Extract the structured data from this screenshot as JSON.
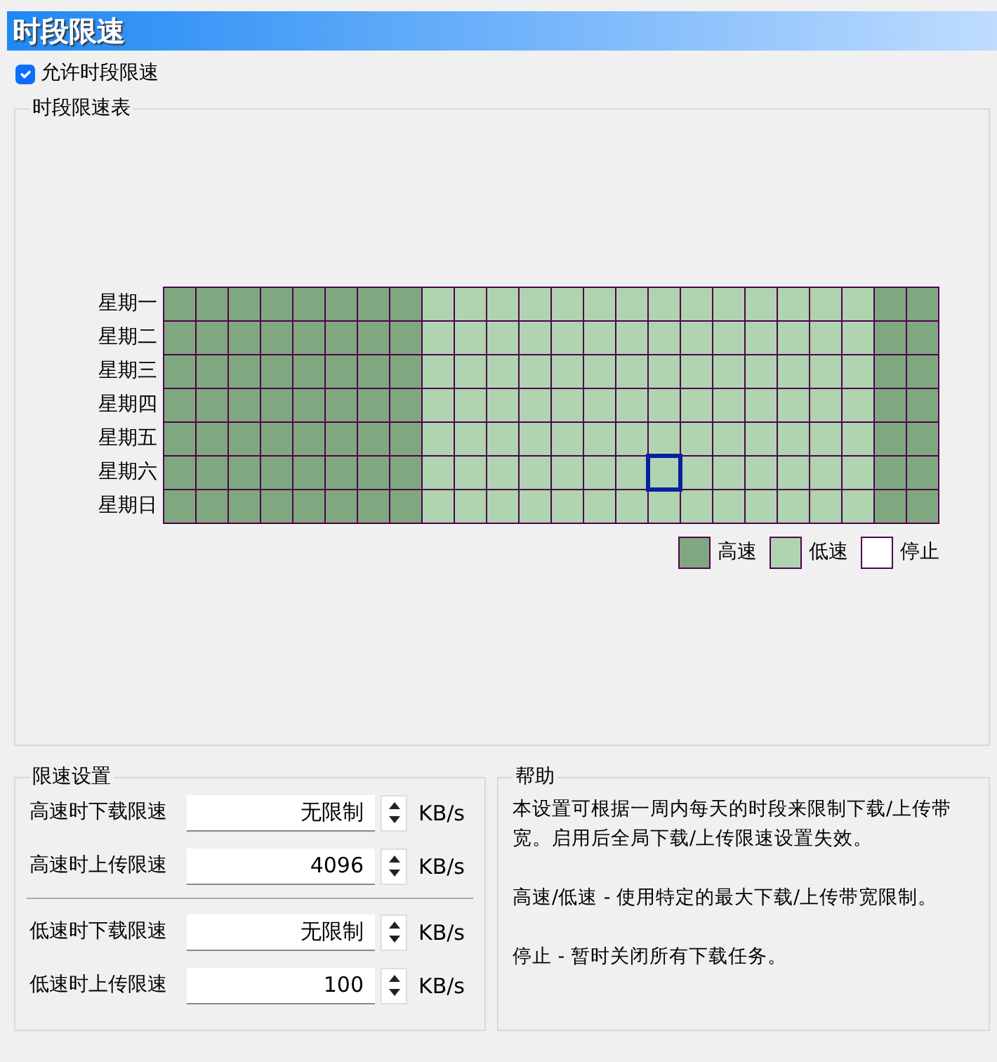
{
  "window": {
    "title": "时段限速"
  },
  "enable": {
    "label": "允许时段限速",
    "checked": true
  },
  "schedule": {
    "title": "时段限速表",
    "rows": [
      {
        "day": "星期一",
        "cells": [
          {
            "kind": "high",
            "selected": false
          },
          {
            "kind": "high",
            "selected": false
          },
          {
            "kind": "high",
            "selected": false
          },
          {
            "kind": "high",
            "selected": false
          },
          {
            "kind": "high",
            "selected": false
          },
          {
            "kind": "high",
            "selected": false
          },
          {
            "kind": "high",
            "selected": false
          },
          {
            "kind": "high",
            "selected": false
          },
          {
            "kind": "low",
            "selected": false
          },
          {
            "kind": "low",
            "selected": false
          },
          {
            "kind": "low",
            "selected": false
          },
          {
            "kind": "low",
            "selected": false
          },
          {
            "kind": "low",
            "selected": false
          },
          {
            "kind": "low",
            "selected": false
          },
          {
            "kind": "low",
            "selected": false
          },
          {
            "kind": "low",
            "selected": false
          },
          {
            "kind": "low",
            "selected": false
          },
          {
            "kind": "low",
            "selected": false
          },
          {
            "kind": "low",
            "selected": false
          },
          {
            "kind": "low",
            "selected": false
          },
          {
            "kind": "low",
            "selected": false
          },
          {
            "kind": "low",
            "selected": false
          },
          {
            "kind": "high",
            "selected": false
          },
          {
            "kind": "high",
            "selected": false
          }
        ]
      },
      {
        "day": "星期二",
        "cells": [
          {
            "kind": "high",
            "selected": false
          },
          {
            "kind": "high",
            "selected": false
          },
          {
            "kind": "high",
            "selected": false
          },
          {
            "kind": "high",
            "selected": false
          },
          {
            "kind": "high",
            "selected": false
          },
          {
            "kind": "high",
            "selected": false
          },
          {
            "kind": "high",
            "selected": false
          },
          {
            "kind": "high",
            "selected": false
          },
          {
            "kind": "low",
            "selected": false
          },
          {
            "kind": "low",
            "selected": false
          },
          {
            "kind": "low",
            "selected": false
          },
          {
            "kind": "low",
            "selected": false
          },
          {
            "kind": "low",
            "selected": false
          },
          {
            "kind": "low",
            "selected": false
          },
          {
            "kind": "low",
            "selected": false
          },
          {
            "kind": "low",
            "selected": false
          },
          {
            "kind": "low",
            "selected": false
          },
          {
            "kind": "low",
            "selected": false
          },
          {
            "kind": "low",
            "selected": false
          },
          {
            "kind": "low",
            "selected": false
          },
          {
            "kind": "low",
            "selected": false
          },
          {
            "kind": "low",
            "selected": false
          },
          {
            "kind": "high",
            "selected": false
          },
          {
            "kind": "high",
            "selected": false
          }
        ]
      },
      {
        "day": "星期三",
        "cells": [
          {
            "kind": "high",
            "selected": false
          },
          {
            "kind": "high",
            "selected": false
          },
          {
            "kind": "high",
            "selected": false
          },
          {
            "kind": "high",
            "selected": false
          },
          {
            "kind": "high",
            "selected": false
          },
          {
            "kind": "high",
            "selected": false
          },
          {
            "kind": "high",
            "selected": false
          },
          {
            "kind": "high",
            "selected": false
          },
          {
            "kind": "low",
            "selected": false
          },
          {
            "kind": "low",
            "selected": false
          },
          {
            "kind": "low",
            "selected": false
          },
          {
            "kind": "low",
            "selected": false
          },
          {
            "kind": "low",
            "selected": false
          },
          {
            "kind": "low",
            "selected": false
          },
          {
            "kind": "low",
            "selected": false
          },
          {
            "kind": "low",
            "selected": false
          },
          {
            "kind": "low",
            "selected": false
          },
          {
            "kind": "low",
            "selected": false
          },
          {
            "kind": "low",
            "selected": false
          },
          {
            "kind": "low",
            "selected": false
          },
          {
            "kind": "low",
            "selected": false
          },
          {
            "kind": "low",
            "selected": false
          },
          {
            "kind": "high",
            "selected": false
          },
          {
            "kind": "high",
            "selected": false
          }
        ]
      },
      {
        "day": "星期四",
        "cells": [
          {
            "kind": "high",
            "selected": false
          },
          {
            "kind": "high",
            "selected": false
          },
          {
            "kind": "high",
            "selected": false
          },
          {
            "kind": "high",
            "selected": false
          },
          {
            "kind": "high",
            "selected": false
          },
          {
            "kind": "high",
            "selected": false
          },
          {
            "kind": "high",
            "selected": false
          },
          {
            "kind": "high",
            "selected": false
          },
          {
            "kind": "low",
            "selected": false
          },
          {
            "kind": "low",
            "selected": false
          },
          {
            "kind": "low",
            "selected": false
          },
          {
            "kind": "low",
            "selected": false
          },
          {
            "kind": "low",
            "selected": false
          },
          {
            "kind": "low",
            "selected": false
          },
          {
            "kind": "low",
            "selected": false
          },
          {
            "kind": "low",
            "selected": false
          },
          {
            "kind": "low",
            "selected": false
          },
          {
            "kind": "low",
            "selected": false
          },
          {
            "kind": "low",
            "selected": false
          },
          {
            "kind": "low",
            "selected": false
          },
          {
            "kind": "low",
            "selected": false
          },
          {
            "kind": "low",
            "selected": false
          },
          {
            "kind": "high",
            "selected": false
          },
          {
            "kind": "high",
            "selected": false
          }
        ]
      },
      {
        "day": "星期五",
        "cells": [
          {
            "kind": "high",
            "selected": false
          },
          {
            "kind": "high",
            "selected": false
          },
          {
            "kind": "high",
            "selected": false
          },
          {
            "kind": "high",
            "selected": false
          },
          {
            "kind": "high",
            "selected": false
          },
          {
            "kind": "high",
            "selected": false
          },
          {
            "kind": "high",
            "selected": false
          },
          {
            "kind": "high",
            "selected": false
          },
          {
            "kind": "low",
            "selected": false
          },
          {
            "kind": "low",
            "selected": false
          },
          {
            "kind": "low",
            "selected": false
          },
          {
            "kind": "low",
            "selected": false
          },
          {
            "kind": "low",
            "selected": false
          },
          {
            "kind": "low",
            "selected": false
          },
          {
            "kind": "low",
            "selected": false
          },
          {
            "kind": "low",
            "selected": false
          },
          {
            "kind": "low",
            "selected": false
          },
          {
            "kind": "low",
            "selected": false
          },
          {
            "kind": "low",
            "selected": false
          },
          {
            "kind": "low",
            "selected": false
          },
          {
            "kind": "low",
            "selected": false
          },
          {
            "kind": "low",
            "selected": false
          },
          {
            "kind": "high",
            "selected": false
          },
          {
            "kind": "high",
            "selected": false
          }
        ]
      },
      {
        "day": "星期六",
        "cells": [
          {
            "kind": "high",
            "selected": false
          },
          {
            "kind": "high",
            "selected": false
          },
          {
            "kind": "high",
            "selected": false
          },
          {
            "kind": "high",
            "selected": false
          },
          {
            "kind": "high",
            "selected": false
          },
          {
            "kind": "high",
            "selected": false
          },
          {
            "kind": "high",
            "selected": false
          },
          {
            "kind": "high",
            "selected": false
          },
          {
            "kind": "low",
            "selected": false
          },
          {
            "kind": "low",
            "selected": false
          },
          {
            "kind": "low",
            "selected": false
          },
          {
            "kind": "low",
            "selected": false
          },
          {
            "kind": "low",
            "selected": false
          },
          {
            "kind": "low",
            "selected": false
          },
          {
            "kind": "low",
            "selected": false
          },
          {
            "kind": "low",
            "selected": true
          },
          {
            "kind": "low",
            "selected": false
          },
          {
            "kind": "low",
            "selected": false
          },
          {
            "kind": "low",
            "selected": false
          },
          {
            "kind": "low",
            "selected": false
          },
          {
            "kind": "low",
            "selected": false
          },
          {
            "kind": "low",
            "selected": false
          },
          {
            "kind": "high",
            "selected": false
          },
          {
            "kind": "high",
            "selected": false
          }
        ]
      },
      {
        "day": "星期日",
        "cells": [
          {
            "kind": "high",
            "selected": false
          },
          {
            "kind": "high",
            "selected": false
          },
          {
            "kind": "high",
            "selected": false
          },
          {
            "kind": "high",
            "selected": false
          },
          {
            "kind": "high",
            "selected": false
          },
          {
            "kind": "high",
            "selected": false
          },
          {
            "kind": "high",
            "selected": false
          },
          {
            "kind": "high",
            "selected": false
          },
          {
            "kind": "low",
            "selected": false
          },
          {
            "kind": "low",
            "selected": false
          },
          {
            "kind": "low",
            "selected": false
          },
          {
            "kind": "low",
            "selected": false
          },
          {
            "kind": "low",
            "selected": false
          },
          {
            "kind": "low",
            "selected": false
          },
          {
            "kind": "low",
            "selected": false
          },
          {
            "kind": "low",
            "selected": false
          },
          {
            "kind": "low",
            "selected": false
          },
          {
            "kind": "low",
            "selected": false
          },
          {
            "kind": "low",
            "selected": false
          },
          {
            "kind": "low",
            "selected": false
          },
          {
            "kind": "low",
            "selected": false
          },
          {
            "kind": "low",
            "selected": false
          },
          {
            "kind": "high",
            "selected": false
          },
          {
            "kind": "high",
            "selected": false
          }
        ]
      }
    ],
    "legend": [
      {
        "kind": "high",
        "label": "高速",
        "color": "#80a880"
      },
      {
        "kind": "low",
        "label": "低速",
        "color": "#b0d4b0"
      },
      {
        "kind": "stop",
        "label": "停止",
        "color": "#ffffff"
      }
    ]
  },
  "limits": {
    "title": "限速设置",
    "groups": [
      [
        {
          "label": "高速时下载限速",
          "value": "无限制",
          "unit": "KB/s"
        },
        {
          "label": "高速时上传限速",
          "value": "4096",
          "unit": "KB/s"
        }
      ],
      [
        {
          "label": "低速时下载限速",
          "value": "无限制",
          "unit": "KB/s"
        },
        {
          "label": "低速时上传限速",
          "value": "100",
          "unit": "KB/s"
        }
      ]
    ]
  },
  "help": {
    "title": "帮助",
    "paragraphs": [
      "本设置可根据一周内每天的时段来限制下载/上传带宽。启用后全局下载/上传限速设置失效。",
      "高速/低速 - 使用特定的最大下载/上传带宽限制。",
      "停止 - 暂时关闭所有下载任务。"
    ]
  }
}
